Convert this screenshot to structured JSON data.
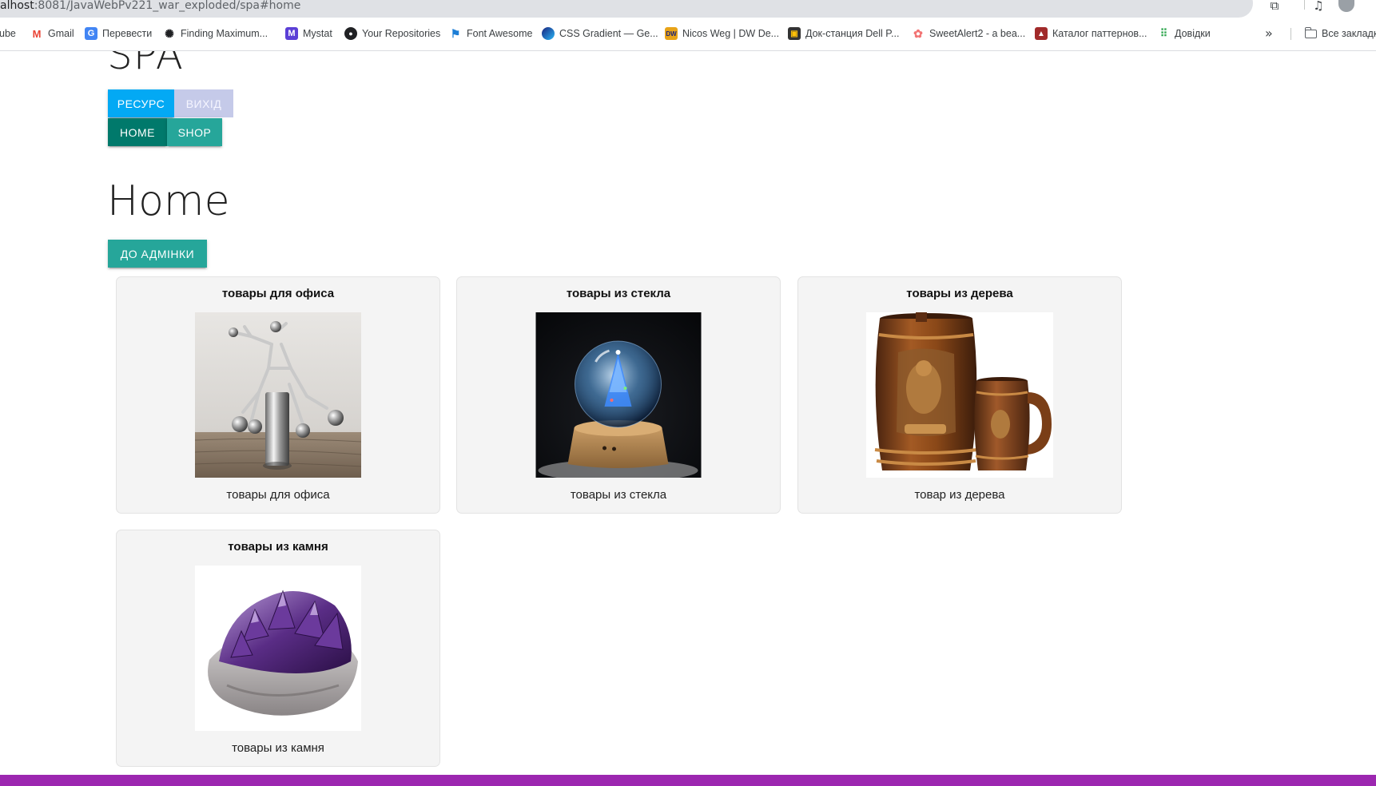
{
  "browser": {
    "url_host": "alhost",
    "url_path": ":8081/JavaWebPv221_war_exploded/spa#home",
    "bookmarks": [
      {
        "label": "ube",
        "icon": "youtube-icon",
        "color": "#ff0000"
      },
      {
        "label": "Gmail",
        "icon": "gmail-icon",
        "color": "#ea4335"
      },
      {
        "label": "Перевести",
        "icon": "translate-icon",
        "color": "#4285f4"
      },
      {
        "label": "Finding Maximum...",
        "icon": "openai-icon",
        "color": "#202124"
      },
      {
        "label": "Mystat",
        "icon": "mystat-icon",
        "color": "#5b3fd6"
      },
      {
        "label": "Your Repositories",
        "icon": "github-icon",
        "color": "#202124"
      },
      {
        "label": "Font Awesome",
        "icon": "flag-icon",
        "color": "#1c7ed6"
      },
      {
        "label": "CSS Gradient — Ge...",
        "icon": "gradient-icon",
        "color": "#1a237e"
      },
      {
        "label": "Nicos Weg | DW De...",
        "icon": "dw-icon",
        "color": "#e8a317"
      },
      {
        "label": "Док-станция Dell P...",
        "icon": "shop-bag-icon",
        "color": "#333333"
      },
      {
        "label": "SweetAlert2 - a bea...",
        "icon": "sweetalert-icon",
        "color": "#f27474"
      },
      {
        "label": "Каталог паттернов...",
        "icon": "refactoring-icon",
        "color": "#a12a2a"
      },
      {
        "label": "Довідки",
        "icon": "apps-icon",
        "color": "#34a853"
      }
    ],
    "all_bookmarks_label": "Все закладк"
  },
  "app": {
    "title": "SPA",
    "buttons": {
      "resource": "РЕСУРС",
      "exit": "ВИХІД",
      "home": "HOME",
      "shop": "SHOP"
    },
    "page_title": "Home",
    "admin_button": "ДО АДМІНКИ"
  },
  "categories": [
    {
      "title": "товары для офиса",
      "description": "товары для офиса",
      "image": "office-toy-image"
    },
    {
      "title": "товары из стекла",
      "description": "товары из стекла",
      "image": "glass-ball-image"
    },
    {
      "title": "товары из дерева",
      "description": "товар из дерева",
      "image": "wooden-mugs-image"
    },
    {
      "title": "товары из камня",
      "description": "товары из камня",
      "image": "amethyst-image"
    }
  ],
  "colors": {
    "resource_button": "#03a9f4",
    "exit_button": "#c5cae9",
    "home_button": "#00796b",
    "shop_button": "#26a69a",
    "admin_button": "#26a69a",
    "footer": "#9c27b0"
  }
}
